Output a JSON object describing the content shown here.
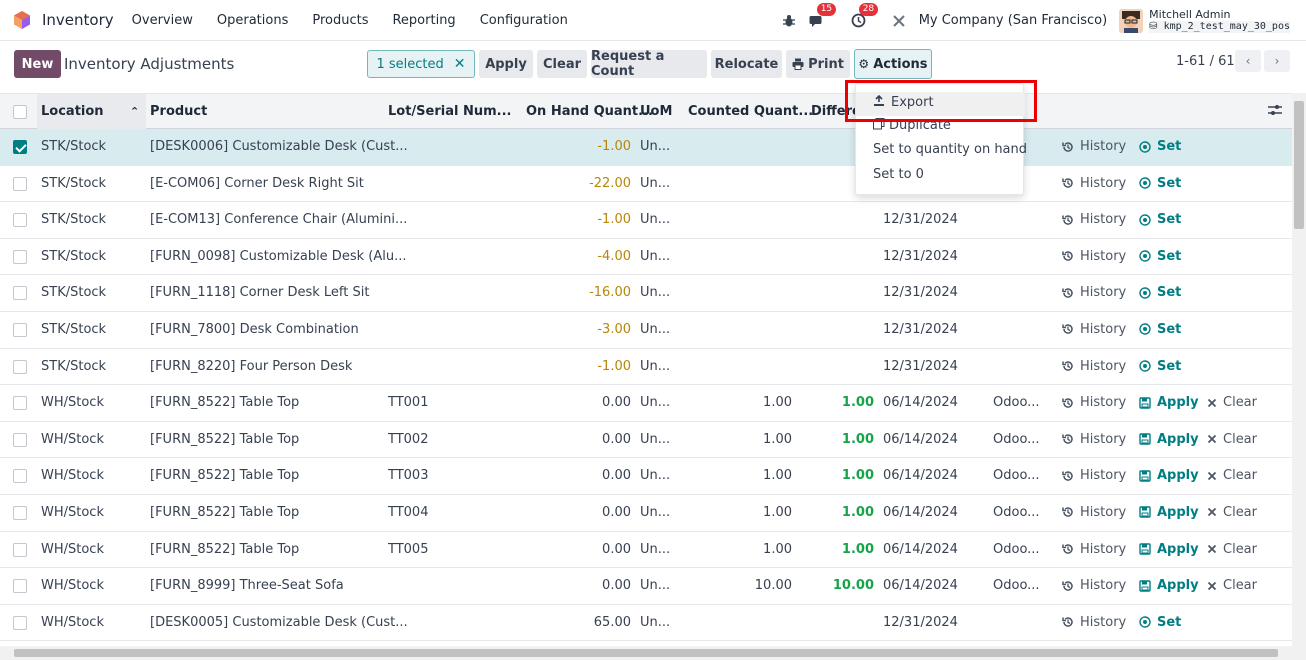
{
  "nav": {
    "app_name": "Inventory",
    "menu": [
      "Overview",
      "Operations",
      "Products",
      "Reporting",
      "Configuration"
    ],
    "chat_badge": "15",
    "activity_badge": "28",
    "company": "My Company (San Francisco)",
    "user": "Mitchell Admin",
    "db": "kmp_2_test_may_30_pos"
  },
  "control": {
    "new_label": "New",
    "title": "Inventory Adjustments",
    "selected_label": "1 selected",
    "buttons": [
      "Apply",
      "Clear",
      "Request a Count",
      "Relocate",
      "Print"
    ],
    "actions_label": "Actions",
    "pager": "1-61 / 61"
  },
  "dropdown": {
    "items": [
      "Export",
      "Duplicate",
      "Set to quantity on hand",
      "Set to 0"
    ]
  },
  "table": {
    "headers": {
      "location": "Location",
      "product": "Product",
      "lot": "Lot/Serial Num...",
      "on_hand": "On Hand Quant...",
      "uom": "UoM",
      "counted": "Counted Quant...",
      "difference": "Differe"
    },
    "actions": {
      "history": "History",
      "set": "Set",
      "apply": "Apply",
      "clear": "Clear"
    },
    "rows": [
      {
        "location": "STK/Stock",
        "product": "[DESK0006] Customizable Desk (Cust...",
        "lot": "",
        "on_hand": "-1.00",
        "uom": "Un...",
        "counted": "",
        "difference": "",
        "date": "",
        "user": "",
        "mode": "set",
        "checked": true
      },
      {
        "location": "STK/Stock",
        "product": "[E-COM06] Corner Desk Right Sit",
        "lot": "",
        "on_hand": "-22.00",
        "uom": "Un...",
        "counted": "",
        "difference": "",
        "date": "",
        "user": "",
        "mode": "set",
        "checked": false
      },
      {
        "location": "STK/Stock",
        "product": "[E-COM13] Conference Chair (Alumini...",
        "lot": "",
        "on_hand": "-1.00",
        "uom": "Un...",
        "counted": "",
        "difference": "",
        "date": "12/31/2024",
        "user": "",
        "mode": "set",
        "checked": false
      },
      {
        "location": "STK/Stock",
        "product": "[FURN_0098] Customizable Desk (Alu...",
        "lot": "",
        "on_hand": "-4.00",
        "uom": "Un...",
        "counted": "",
        "difference": "",
        "date": "12/31/2024",
        "user": "",
        "mode": "set",
        "checked": false
      },
      {
        "location": "STK/Stock",
        "product": "[FURN_1118] Corner Desk Left Sit",
        "lot": "",
        "on_hand": "-16.00",
        "uom": "Un...",
        "counted": "",
        "difference": "",
        "date": "12/31/2024",
        "user": "",
        "mode": "set",
        "checked": false
      },
      {
        "location": "STK/Stock",
        "product": "[FURN_7800] Desk Combination",
        "lot": "",
        "on_hand": "-3.00",
        "uom": "Un...",
        "counted": "",
        "difference": "",
        "date": "12/31/2024",
        "user": "",
        "mode": "set",
        "checked": false
      },
      {
        "location": "STK/Stock",
        "product": "[FURN_8220] Four Person Desk",
        "lot": "",
        "on_hand": "-1.00",
        "uom": "Un...",
        "counted": "",
        "difference": "",
        "date": "12/31/2024",
        "user": "",
        "mode": "set",
        "checked": false
      },
      {
        "location": "WH/Stock",
        "product": "[FURN_8522] Table Top",
        "lot": "TT001",
        "on_hand": "0.00",
        "uom": "Un...",
        "counted": "1.00",
        "difference": "1.00",
        "date": "06/14/2024",
        "user": "Odoo...",
        "mode": "apply",
        "checked": false
      },
      {
        "location": "WH/Stock",
        "product": "[FURN_8522] Table Top",
        "lot": "TT002",
        "on_hand": "0.00",
        "uom": "Un...",
        "counted": "1.00",
        "difference": "1.00",
        "date": "06/14/2024",
        "user": "Odoo...",
        "mode": "apply",
        "checked": false
      },
      {
        "location": "WH/Stock",
        "product": "[FURN_8522] Table Top",
        "lot": "TT003",
        "on_hand": "0.00",
        "uom": "Un...",
        "counted": "1.00",
        "difference": "1.00",
        "date": "06/14/2024",
        "user": "Odoo...",
        "mode": "apply",
        "checked": false
      },
      {
        "location": "WH/Stock",
        "product": "[FURN_8522] Table Top",
        "lot": "TT004",
        "on_hand": "0.00",
        "uom": "Un...",
        "counted": "1.00",
        "difference": "1.00",
        "date": "06/14/2024",
        "user": "Odoo...",
        "mode": "apply",
        "checked": false
      },
      {
        "location": "WH/Stock",
        "product": "[FURN_8522] Table Top",
        "lot": "TT005",
        "on_hand": "0.00",
        "uom": "Un...",
        "counted": "1.00",
        "difference": "1.00",
        "date": "06/14/2024",
        "user": "Odoo...",
        "mode": "apply",
        "checked": false
      },
      {
        "location": "WH/Stock",
        "product": "[FURN_8999] Three-Seat Sofa",
        "lot": "",
        "on_hand": "0.00",
        "uom": "Un...",
        "counted": "10.00",
        "difference": "10.00",
        "date": "06/14/2024",
        "user": "Odoo...",
        "mode": "apply",
        "checked": false
      },
      {
        "location": "WH/Stock",
        "product": "[DESK0005] Customizable Desk (Cust...",
        "lot": "",
        "on_hand": "65.00",
        "uom": "Un...",
        "counted": "",
        "difference": "",
        "date": "12/31/2024",
        "user": "",
        "mode": "set",
        "checked": false
      }
    ]
  },
  "colors": {
    "brand": "#714b67",
    "teal": "#017e84",
    "negative": "#b7860b",
    "positive": "#16a34a",
    "highlight": "#e00000"
  }
}
